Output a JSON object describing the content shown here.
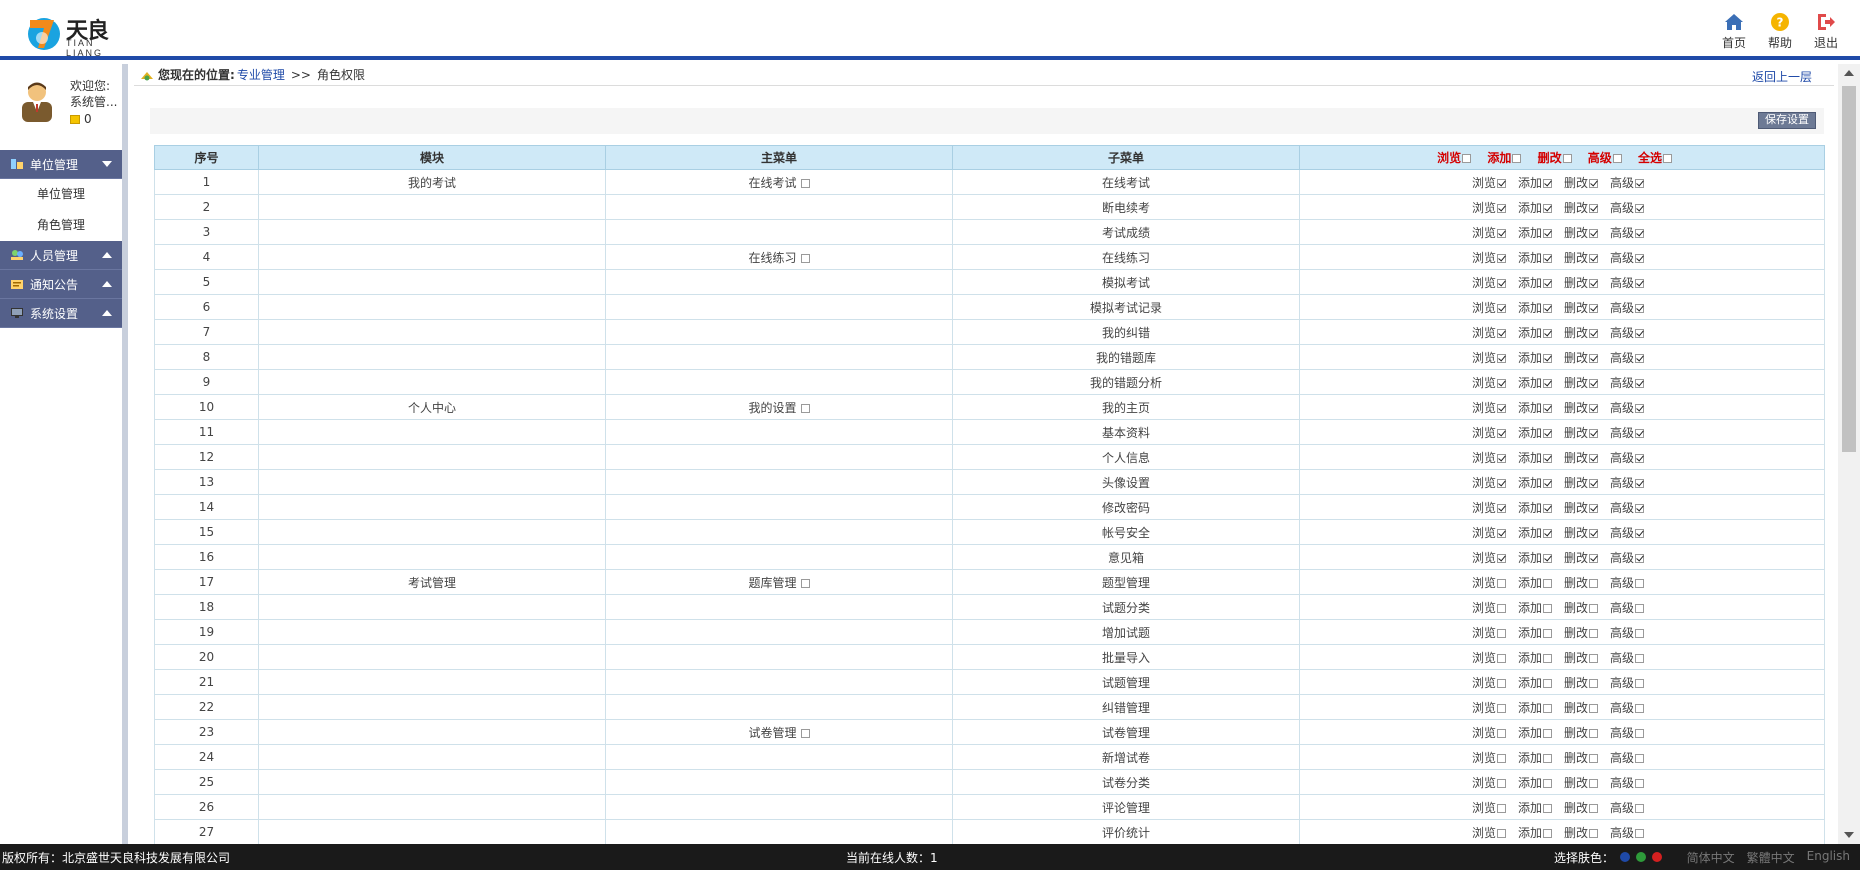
{
  "header": {
    "logo_text": "天良",
    "logo_sub": "TIAN LIANG",
    "nav": [
      {
        "label": "首页",
        "icon": "home-icon"
      },
      {
        "label": "帮助",
        "icon": "help-icon"
      },
      {
        "label": "退出",
        "icon": "logout-icon"
      }
    ]
  },
  "sidebar": {
    "welcome_line1": "欢迎您:",
    "welcome_line2": "系统管...",
    "coins": "0",
    "menus": [
      {
        "label": "单位管理",
        "expanded": true,
        "children": [
          "单位管理",
          "角色管理"
        ]
      },
      {
        "label": "人员管理",
        "expanded": false
      },
      {
        "label": "通知公告",
        "expanded": false
      },
      {
        "label": "系统设置",
        "expanded": false
      }
    ]
  },
  "breadcrumb": {
    "label": "您现在的位置:",
    "link": "专业管理",
    "sep": ">>",
    "current": "角色权限",
    "back": "返回上一层"
  },
  "toolbar": {
    "save_label": "保存设置"
  },
  "table": {
    "headers": [
      "序号",
      "模块",
      "主菜单",
      "子菜单"
    ],
    "perm_headers": [
      "浏览",
      "添加",
      "删改",
      "高级",
      "全选"
    ],
    "perm_labels": [
      "浏览",
      "添加",
      "删改",
      "高级"
    ],
    "rows": [
      {
        "no": "1",
        "module": "我的考试",
        "menu": "在线考试",
        "sub": "在线考试",
        "checked": true
      },
      {
        "no": "2",
        "module": "",
        "menu": "",
        "sub": "断电续考",
        "checked": true
      },
      {
        "no": "3",
        "module": "",
        "menu": "",
        "sub": "考试成绩",
        "checked": true
      },
      {
        "no": "4",
        "module": "",
        "menu": "在线练习",
        "sub": "在线练习",
        "checked": true
      },
      {
        "no": "5",
        "module": "",
        "menu": "",
        "sub": "模拟考试",
        "checked": true
      },
      {
        "no": "6",
        "module": "",
        "menu": "",
        "sub": "模拟考试记录",
        "checked": true
      },
      {
        "no": "7",
        "module": "",
        "menu": "",
        "sub": "我的纠错",
        "checked": true
      },
      {
        "no": "8",
        "module": "",
        "menu": "",
        "sub": "我的错题库",
        "checked": true
      },
      {
        "no": "9",
        "module": "",
        "menu": "",
        "sub": "我的错题分析",
        "checked": true
      },
      {
        "no": "10",
        "module": "个人中心",
        "menu": "我的设置",
        "sub": "我的主页",
        "checked": true
      },
      {
        "no": "11",
        "module": "",
        "menu": "",
        "sub": "基本资料",
        "checked": true
      },
      {
        "no": "12",
        "module": "",
        "menu": "",
        "sub": "个人信息",
        "checked": true
      },
      {
        "no": "13",
        "module": "",
        "menu": "",
        "sub": "头像设置",
        "checked": true
      },
      {
        "no": "14",
        "module": "",
        "menu": "",
        "sub": "修改密码",
        "checked": true
      },
      {
        "no": "15",
        "module": "",
        "menu": "",
        "sub": "帐号安全",
        "checked": true
      },
      {
        "no": "16",
        "module": "",
        "menu": "",
        "sub": "意见箱",
        "checked": true
      },
      {
        "no": "17",
        "module": "考试管理",
        "menu": "题库管理",
        "sub": "题型管理",
        "checked": false
      },
      {
        "no": "18",
        "module": "",
        "menu": "",
        "sub": "试题分类",
        "checked": false
      },
      {
        "no": "19",
        "module": "",
        "menu": "",
        "sub": "增加试题",
        "checked": false
      },
      {
        "no": "20",
        "module": "",
        "menu": "",
        "sub": "批量导入",
        "checked": false
      },
      {
        "no": "21",
        "module": "",
        "menu": "",
        "sub": "试题管理",
        "checked": false
      },
      {
        "no": "22",
        "module": "",
        "menu": "",
        "sub": "纠错管理",
        "checked": false
      },
      {
        "no": "23",
        "module": "",
        "menu": "试卷管理",
        "sub": "试卷管理",
        "checked": false
      },
      {
        "no": "24",
        "module": "",
        "menu": "",
        "sub": "新增试卷",
        "checked": false
      },
      {
        "no": "25",
        "module": "",
        "menu": "",
        "sub": "试卷分类",
        "checked": false
      },
      {
        "no": "26",
        "module": "",
        "menu": "",
        "sub": "评论管理",
        "checked": false
      },
      {
        "no": "27",
        "module": "",
        "menu": "",
        "sub": "评价统计",
        "checked": false
      }
    ]
  },
  "footer": {
    "copyright": "版权所有：北京盛世天良科技发展有限公司",
    "online": "当前在线人数：1",
    "skin_label": "选择肤色：",
    "skin_colors": [
      "#1f4aa8",
      "#2e9b3a",
      "#d42020"
    ],
    "langs": [
      "简体中文",
      "繁體中文",
      "English"
    ]
  }
}
